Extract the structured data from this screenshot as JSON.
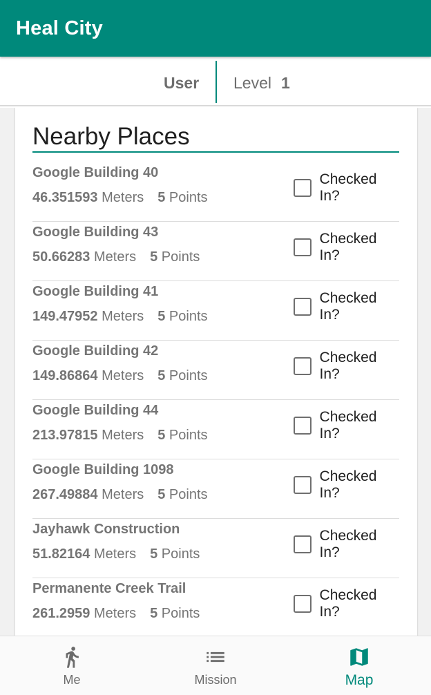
{
  "app": {
    "title": "Heal City"
  },
  "userbar": {
    "user_label": "User",
    "level_label": "Level",
    "level_value": "1"
  },
  "nearby": {
    "heading": "Nearby Places",
    "checkbox_label": "Checked In?",
    "meters_unit": "Meters",
    "points_unit": "Points",
    "places": [
      {
        "name": "Google Building 40",
        "distance": "46.351593",
        "points": "5",
        "checked": false
      },
      {
        "name": "Google Building 43",
        "distance": "50.66283",
        "points": "5",
        "checked": false
      },
      {
        "name": "Google Building 41",
        "distance": "149.47952",
        "points": "5",
        "checked": false
      },
      {
        "name": "Google Building 42",
        "distance": "149.86864",
        "points": "5",
        "checked": false
      },
      {
        "name": "Google Building 44",
        "distance": "213.97815",
        "points": "5",
        "checked": false
      },
      {
        "name": "Google Building 1098",
        "distance": "267.49884",
        "points": "5",
        "checked": false
      },
      {
        "name": "Jayhawk Construction",
        "distance": "51.82164",
        "points": "5",
        "checked": false
      },
      {
        "name": "Permanente Creek Trail",
        "distance": "261.2959",
        "points": "5",
        "checked": false
      }
    ]
  },
  "bottom_nav": {
    "items": [
      {
        "label": "Me",
        "icon": "walking-person-icon",
        "active": false
      },
      {
        "label": "Mission",
        "icon": "list-icon",
        "active": false
      },
      {
        "label": "Map",
        "icon": "map-icon",
        "active": true
      }
    ]
  },
  "colors": {
    "primary": "#00897b",
    "text_gray": "#757575",
    "background": "#f1f1f1"
  }
}
